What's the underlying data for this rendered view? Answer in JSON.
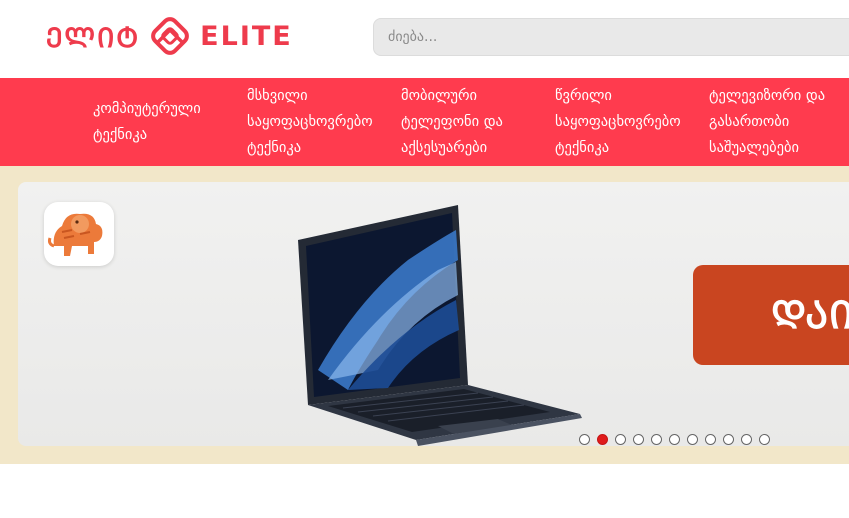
{
  "header": {
    "logo_left": "ᲔᲚᲘᲢ",
    "logo_right": "ELITE",
    "search_placeholder": "ძიება..."
  },
  "nav": {
    "items": [
      {
        "label_lines": [
          "კომპიუტერული",
          "ტექნიკა"
        ]
      },
      {
        "label_lines": [
          "მსხვილი",
          "საყოფაცხოვრებო",
          "ტექნიკა"
        ]
      },
      {
        "label_lines": [
          "მობილური",
          "ტელეფონი და",
          "აქსესუარები"
        ]
      },
      {
        "label_lines": [
          "წვრილი",
          "საყოფაცხოვრებო",
          "ტექნიკა"
        ]
      },
      {
        "label_lines": [
          "ტელევიზორი და",
          "გასართობი",
          "საშუალებები"
        ]
      }
    ]
  },
  "banner": {
    "promo_text": "ᲓᲐᲘᲑ",
    "slide_count": 11,
    "active_slide": 2
  },
  "colors": {
    "brand_red": "#ff3b4e",
    "banner_bg": "#f2e7c9",
    "promo_bg": "#c94520",
    "active_dot": "#e01b1b"
  },
  "icons": [
    "logo-mark-icon",
    "lion-app-icon",
    "laptop-image"
  ]
}
